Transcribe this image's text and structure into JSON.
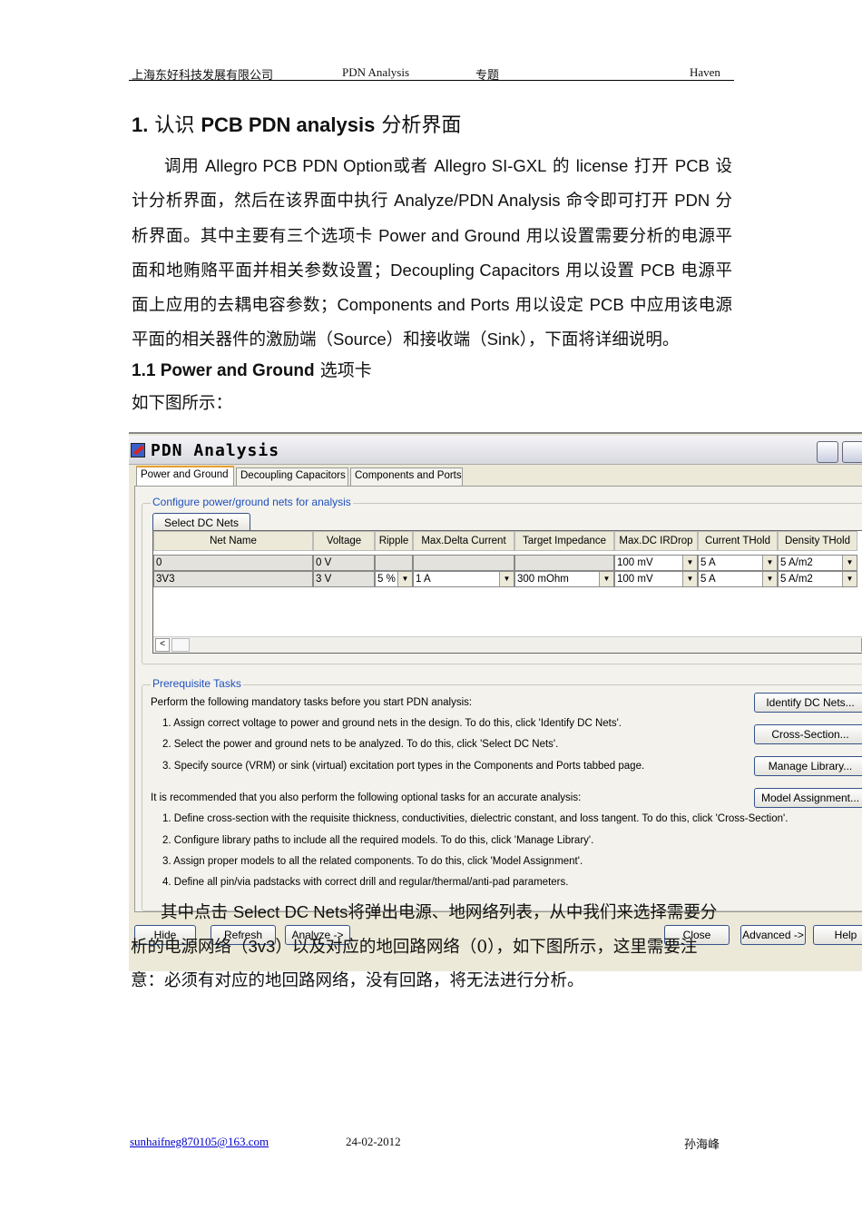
{
  "header": {
    "company": "上海东好科技发展有限公司",
    "topic": "PDN Analysis",
    "special": "专题",
    "author": "Haven"
  },
  "section1": {
    "num": "1.",
    "pre": "认识 ",
    "bold": "PCB PDN analysis",
    "post": " 分析界面"
  },
  "paragraph": [
    {
      "t": "调用 ",
      "c": "zh"
    },
    {
      "t": "Allegro PCB PDN Option",
      "c": "en"
    },
    {
      "t": "或者 ",
      "c": "zh"
    },
    {
      "t": "Allegro SI-GXL",
      "c": "en"
    },
    {
      "t": " 的 ",
      "c": "zh"
    },
    {
      "t": "license",
      "c": "en"
    },
    {
      "t": " 打开 ",
      "c": "zh"
    },
    {
      "t": "PCB",
      "c": "en"
    },
    {
      "t": " 设计分析界面，然后在该界面中执行 ",
      "c": "zh"
    },
    {
      "t": "Analyze/PDN Analysis",
      "c": "en"
    },
    {
      "t": " 命令即可打开 ",
      "c": "zh"
    },
    {
      "t": "PDN",
      "c": "en"
    },
    {
      "t": " 分析界面。其中主要有三个选项卡 ",
      "c": "zh"
    },
    {
      "t": "Power and Ground",
      "c": "en"
    },
    {
      "t": " 用以设置需要分析的电源平面和地贿赂平面并相关参数设置；",
      "c": "zh"
    },
    {
      "t": "Decoupling Capacitors",
      "c": "en"
    },
    {
      "t": " 用以设置 ",
      "c": "zh"
    },
    {
      "t": "PCB",
      "c": "en"
    },
    {
      "t": " 电源平面上应用的去耦电容参数；",
      "c": "zh"
    },
    {
      "t": "Components and Ports",
      "c": "en"
    },
    {
      "t": " 用以设定 ",
      "c": "zh"
    },
    {
      "t": "PCB",
      "c": "en"
    },
    {
      "t": " 中应用该电源平面的相关器件的激励端（",
      "c": "zh"
    },
    {
      "t": "Source",
      "c": "en"
    },
    {
      "t": "）和接收端（",
      "c": "zh"
    },
    {
      "t": "Sink",
      "c": "en"
    },
    {
      "t": "），下面将详细说明。",
      "c": "zh"
    }
  ],
  "section11": {
    "bold": "1.1 Power and Ground",
    "post": " 选项卡"
  },
  "caption": "如下图所示：",
  "dialog": {
    "title": "PDN Analysis",
    "tabs": [
      "Power and Ground",
      "Decoupling Capacitors",
      "Components and Ports"
    ],
    "active_tab": "Power and Ground",
    "config_legend": "Configure power/ground nets for analysis",
    "select_dc_nets": "Select DC Nets",
    "columns": [
      "Net Name",
      "Voltage",
      "Ripple",
      "Max.Delta Current",
      "Target Impedance",
      "Max.DC IRDrop",
      "Current THold",
      "Density THold"
    ],
    "rows": [
      [
        "0",
        "0 V",
        "",
        "",
        "",
        "100 mV",
        "5 A",
        "5 A/m2"
      ],
      [
        "3V3",
        "3 V",
        "5 %",
        "1 A",
        "300 mOhm",
        "100 mV",
        "5 A",
        "5 A/m2"
      ]
    ],
    "prereq_legend": "Prerequisite Tasks",
    "mandatory_intro": "Perform the following mandatory tasks before you start PDN analysis:",
    "mandatory": [
      "1. Assign correct voltage to power and ground nets in the design. To do this, click 'Identify DC Nets'.",
      "2. Select the power and ground nets to be analyzed. To do this, click 'Select DC Nets'.",
      "3. Specify source (VRM) or sink (virtual) excitation port types in the Components and Ports tabbed page."
    ],
    "optional_intro": "It is recommended that you also perform the following optional tasks for an accurate analysis:",
    "optional": [
      "1. Define cross-section with the requisite thickness, conductivities, dielectric constant, and loss tangent. To do this, click 'Cross-Section'.",
      "2. Configure library paths to include all the required models.  To do this, click 'Manage Library'.",
      "3. Assign proper models to all the related components.  To do this, click 'Model Assignment'.",
      "4. Define all pin/via padstacks with correct drill and regular/thermal/anti-pad parameters."
    ],
    "side_buttons": [
      "Identify DC Nets...",
      "Cross-Section...",
      "Manage Library...",
      "Model Assignment..."
    ],
    "bottom_buttons": [
      "Hide",
      "Refresh",
      "Analyze ->",
      "Close",
      "Advanced ->",
      "Help"
    ]
  },
  "overlay_lines": [
    {
      "pre": "其中点击 ",
      "en": "Select DC Nets",
      "post": "将弹出电源、地网络列表，从中我们来选择需要分"
    },
    {
      "pre": "析的电源网络（",
      "en": "3v3",
      "post": "）以及对应的地回路网络（0），如下图所示，这里需要注"
    },
    {
      "pre": "意：必须有对应的地回路网络，没有回路，将无法进行分析。",
      "en": "",
      "post": ""
    }
  ],
  "footer": {
    "email": "sunhaifneg870105@163.com",
    "date": "24-02-2012",
    "name": "孙海峰"
  }
}
